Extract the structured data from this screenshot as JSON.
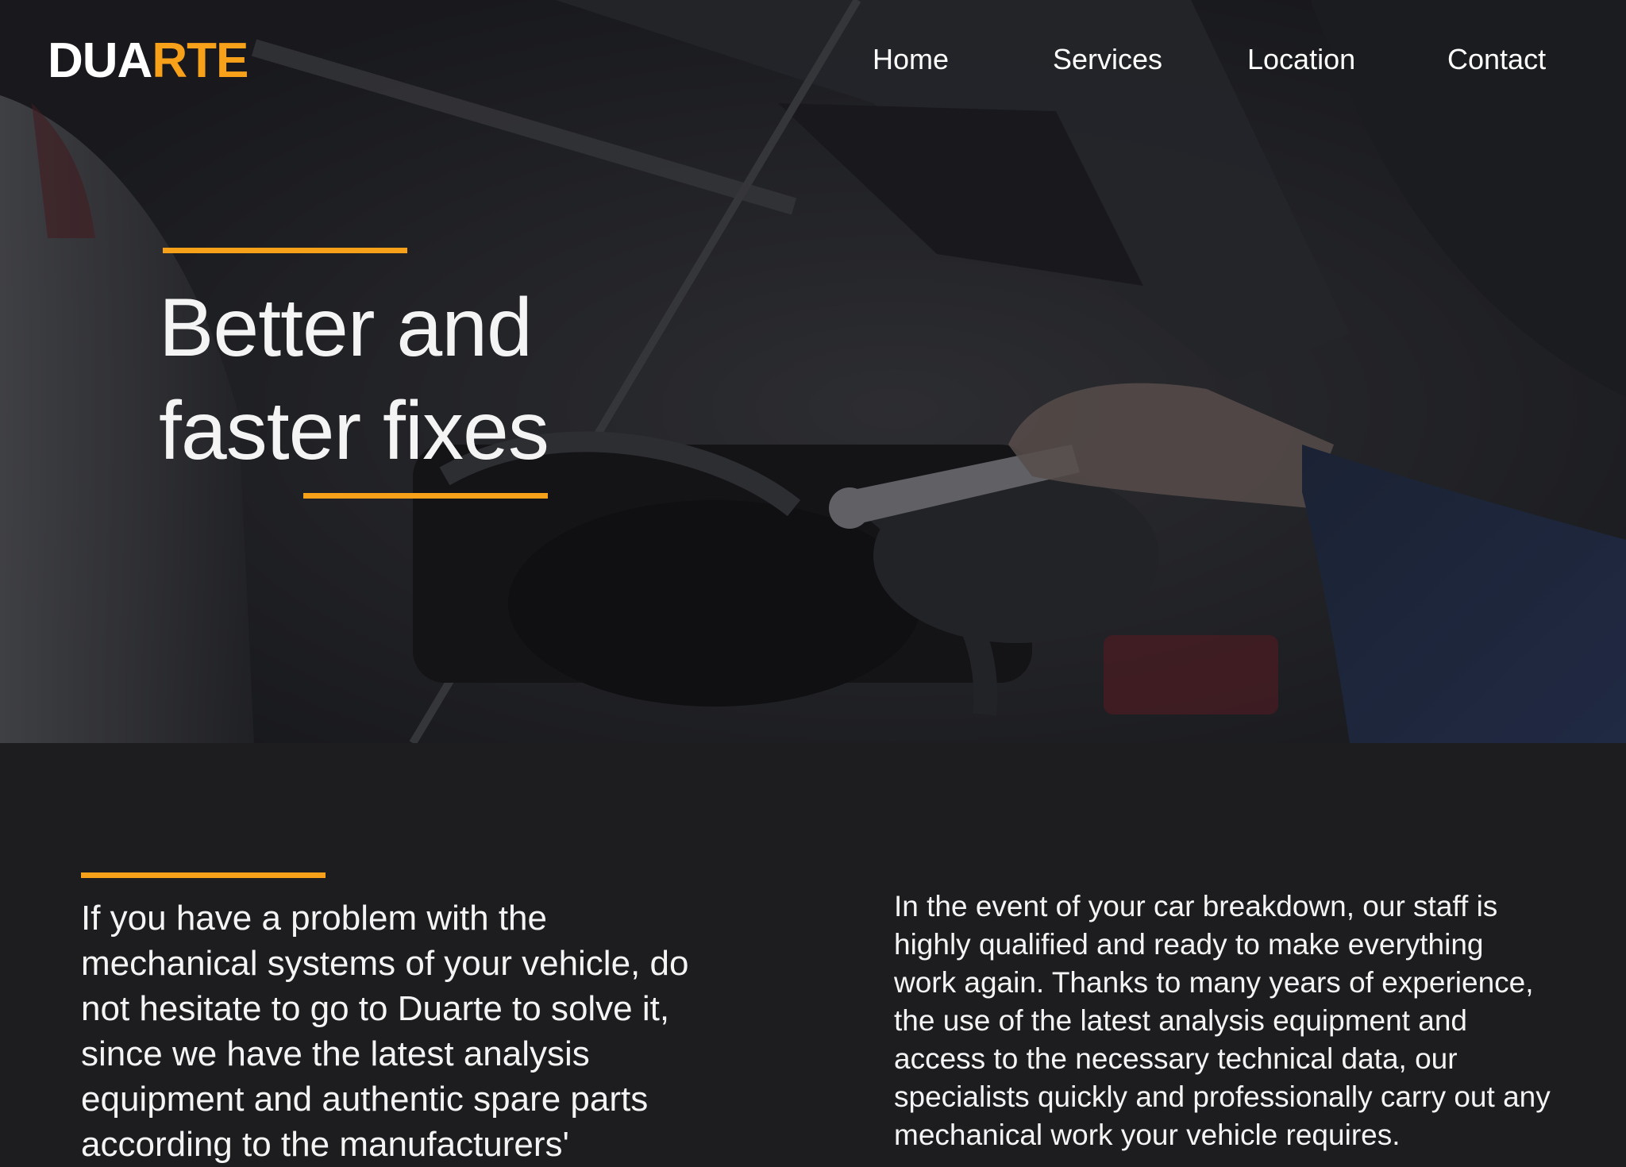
{
  "header": {
    "logo_part1": "DUA",
    "logo_part2": "RTE",
    "nav": {
      "home": "Home",
      "services": "Services",
      "location": "Location",
      "contact": "Contact"
    }
  },
  "hero": {
    "title_line1": "Better and",
    "title_line2": "faster fixes"
  },
  "intro": {
    "left_text": "If you have a problem with the mechanical systems of your vehicle, do not hesitate to go to Duarte to solve it, since we have the latest analysis equipment and authentic spare parts according to the manufacturers'",
    "right_text": "In the event of your car breakdown, our staff is highly qualified and ready to make everything work again. Thanks to many years of experience, the use of the latest analysis equipment and access to the necessary technical data, our specialists quickly and professionally carry out any mechanical work your vehicle requires."
  },
  "colors": {
    "accent": "#f7a01a",
    "background": "#1d1d20",
    "text": "#f4f4f4"
  }
}
